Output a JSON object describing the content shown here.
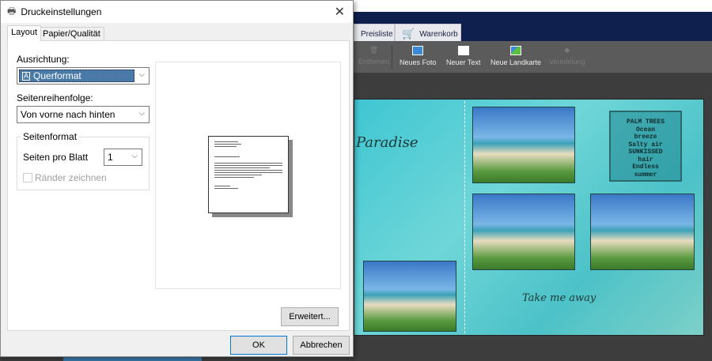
{
  "app": {
    "nav_tabs": [
      "Preisliste",
      "Warenkorb"
    ],
    "toolbar": [
      {
        "label": "Entfernen",
        "icon": "trash-icon",
        "disabled": true
      },
      {
        "label": "Neues Foto",
        "icon": "add-photo-icon"
      },
      {
        "label": "Neuer Text",
        "icon": "add-text-icon"
      },
      {
        "label": "Neue Landkarte",
        "icon": "add-map-icon"
      },
      {
        "label": "Veredelung",
        "icon": "diamond-icon",
        "disabled": true
      }
    ],
    "page_text": {
      "paradise": "Paradise",
      "take_me_away": "Take me away",
      "word_box": [
        "PALM TREES",
        "Ocean",
        "breeze",
        "Salty air",
        "SUNKISSED",
        "hair",
        "Endless",
        "summer"
      ]
    }
  },
  "dialog": {
    "title": "Druckeinstellungen",
    "close": "✕",
    "tabs": [
      "Layout",
      "Papier/Qualität"
    ],
    "orientation_label": "Ausrichtung:",
    "orientation_value": "Querformat",
    "order_label": "Seitenreihenfolge:",
    "order_value": "Von vorne nach hinten",
    "group_title": "Seitenformat",
    "pages_per_sheet_label": "Seiten pro Blatt",
    "pages_per_sheet_value": "1",
    "draw_borders_label": "Ränder zeichnen",
    "advanced_button": "Erweitert...",
    "ok_button": "OK",
    "cancel_button": "Abbrechen"
  }
}
